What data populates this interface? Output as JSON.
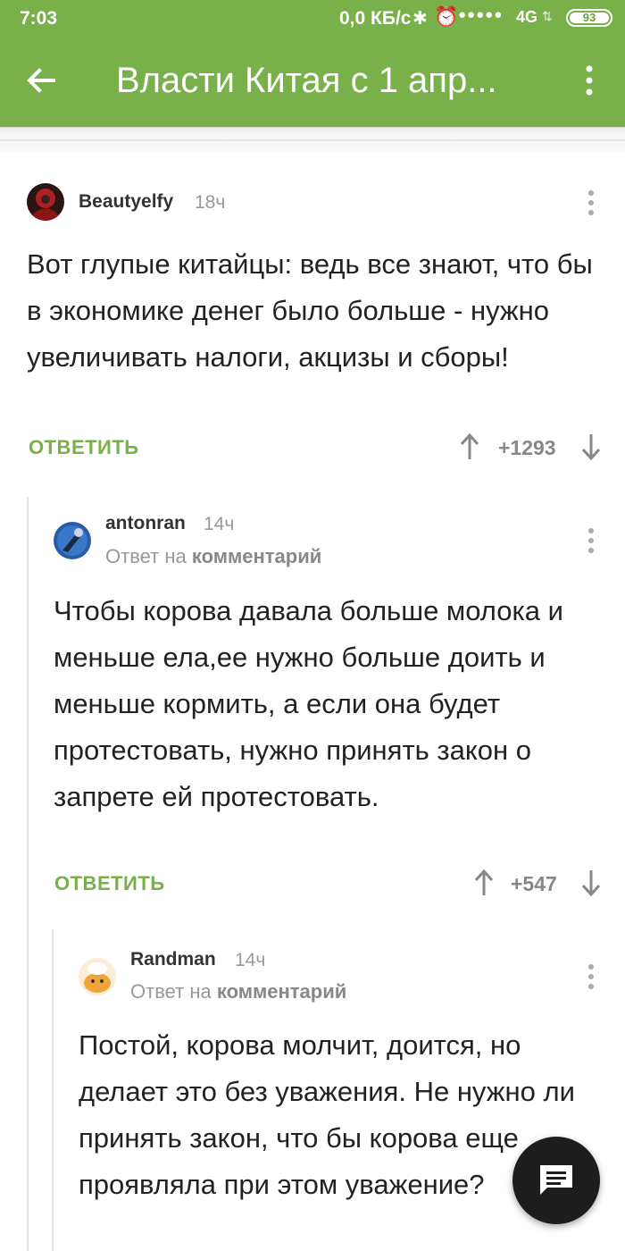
{
  "status_bar": {
    "time": "7:03",
    "network_speed": "0,0 КБ/с",
    "network_type": "4G",
    "battery": "93"
  },
  "app_bar": {
    "title": "Власти Китая с 1 апр...",
    "accent_color": "#79b04a"
  },
  "comments": [
    {
      "username": "Beautyelfy",
      "time": "18ч",
      "reply_to_label": "",
      "reply_to_link": "",
      "text": "Вот глупые китайцы: ведь все знают, что бы в экономике денег было больше - нужно увеличивать налоги, акцизы и сборы!",
      "reply_label": "ОТВЕТИТЬ",
      "rating": "+1293"
    },
    {
      "username": "antonran",
      "time": "14ч",
      "reply_to_label": "Ответ на",
      "reply_to_link": "комментарий",
      "text": "Чтобы корова давала больше молока и меньше ела,ее нужно больше доить и меньше кормить, а если она будет протестовать, нужно принять закон о запрете ей протестовать.",
      "reply_label": "ОТВЕТИТЬ",
      "rating": "+547"
    },
    {
      "username": "Randman",
      "time": "14ч",
      "reply_to_label": "Ответ на",
      "reply_to_link": "комментарий",
      "text": "Постой, корова молчит, доится, но делает это без уважения. Не нужно ли принять закон, что бы корова еще проявляла при этом уважение?"
    }
  ],
  "icons": {
    "back": "arrow-left-icon",
    "menu": "more-vertical-icon",
    "vote_up": "arrow-up-icon",
    "vote_down": "arrow-down-icon",
    "fab": "comment-icon"
  }
}
